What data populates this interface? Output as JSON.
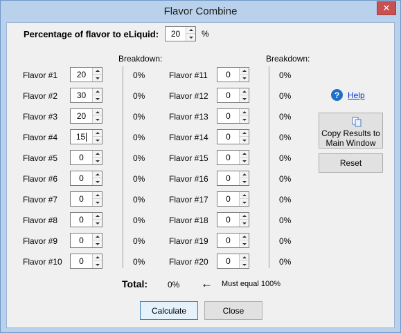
{
  "window": {
    "title": "Flavor Combine"
  },
  "percentage": {
    "label": "Percentage of flavor to eLiquid:",
    "value": "20",
    "unit": "%"
  },
  "breakdown_header": "Breakdown:",
  "flavors_left": [
    {
      "label": "Flavor #1",
      "value": "20",
      "breakdown": "0%"
    },
    {
      "label": "Flavor #2",
      "value": "30",
      "breakdown": "0%"
    },
    {
      "label": "Flavor #3",
      "value": "20",
      "breakdown": "0%"
    },
    {
      "label": "Flavor #4",
      "value": "15",
      "breakdown": "0%"
    },
    {
      "label": "Flavor #5",
      "value": "0",
      "breakdown": "0%"
    },
    {
      "label": "Flavor #6",
      "value": "0",
      "breakdown": "0%"
    },
    {
      "label": "Flavor #7",
      "value": "0",
      "breakdown": "0%"
    },
    {
      "label": "Flavor #8",
      "value": "0",
      "breakdown": "0%"
    },
    {
      "label": "Flavor #9",
      "value": "0",
      "breakdown": "0%"
    },
    {
      "label": "Flavor #10",
      "value": "0",
      "breakdown": "0%"
    }
  ],
  "flavors_right": [
    {
      "label": "Flavor #11",
      "value": "0",
      "breakdown": "0%"
    },
    {
      "label": "Flavor #12",
      "value": "0",
      "breakdown": "0%"
    },
    {
      "label": "Flavor #13",
      "value": "0",
      "breakdown": "0%"
    },
    {
      "label": "Flavor #14",
      "value": "0",
      "breakdown": "0%"
    },
    {
      "label": "Flavor #15",
      "value": "0",
      "breakdown": "0%"
    },
    {
      "label": "Flavor #16",
      "value": "0",
      "breakdown": "0%"
    },
    {
      "label": "Flavor #17",
      "value": "0",
      "breakdown": "0%"
    },
    {
      "label": "Flavor #18",
      "value": "0",
      "breakdown": "0%"
    },
    {
      "label": "Flavor #19",
      "value": "0",
      "breakdown": "0%"
    },
    {
      "label": "Flavor #20",
      "value": "0",
      "breakdown": "0%"
    }
  ],
  "help": {
    "label": "Help",
    "icon": "help-icon"
  },
  "buttons": {
    "copy_line1": "Copy Results to",
    "copy_line2": "Main Window",
    "reset": "Reset",
    "calculate": "Calculate",
    "close": "Close"
  },
  "total": {
    "label": "Total:",
    "value": "0%",
    "arrow": "←",
    "note": "Must equal 100%"
  },
  "colors": {
    "titlebar": "#b9d1ea",
    "client": "#f0f0f0",
    "close_button": "#c75050",
    "link": "#0033cc"
  }
}
